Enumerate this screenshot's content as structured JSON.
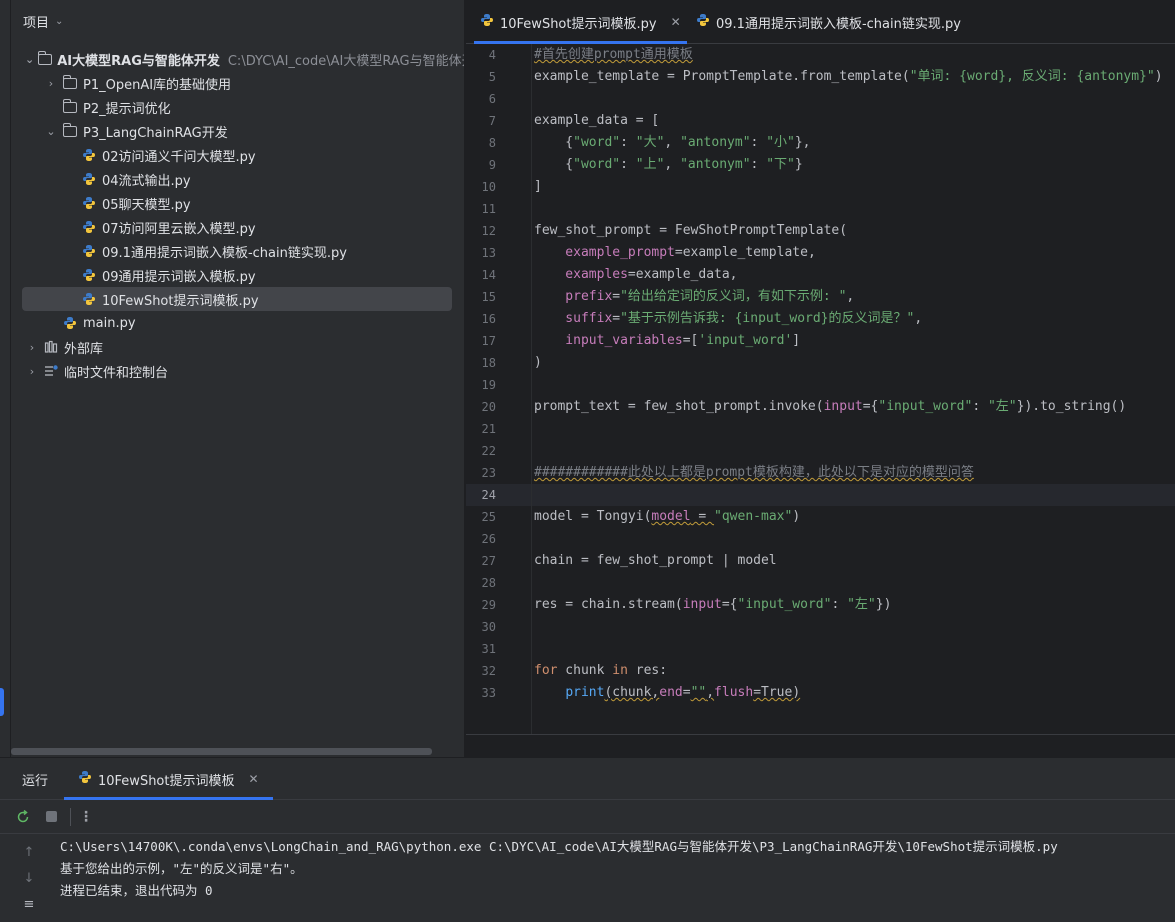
{
  "project_panel": {
    "header": "项目",
    "tree": [
      {
        "label": "AI大模型RAG与智能体开发",
        "path": "C:\\DYC\\AI_code\\AI大模型RAG与智能体开",
        "bold": true
      },
      {
        "label": "P1_OpenAI库的基础使用"
      },
      {
        "label": "P2_提示词优化"
      },
      {
        "label": "P3_LangChainRAG开发"
      },
      {
        "label": "02访问通义千问大模型.py"
      },
      {
        "label": "04流式输出.py"
      },
      {
        "label": "05聊天模型.py"
      },
      {
        "label": "07访问阿里云嵌入模型.py"
      },
      {
        "label": "09.1通用提示词嵌入模板-chain链实现.py"
      },
      {
        "label": "09通用提示词嵌入模板.py"
      },
      {
        "label": "10FewShot提示词模板.py"
      },
      {
        "label": "main.py"
      },
      {
        "label": "外部库"
      },
      {
        "label": "临时文件和控制台"
      }
    ]
  },
  "editor": {
    "tabs": [
      {
        "label": "10FewShot提示词模板.py",
        "active": true
      },
      {
        "label": "09.1通用提示词嵌入模板-chain链实现.py",
        "active": false
      }
    ],
    "line_numbers": [
      "4",
      "5",
      "6",
      "7",
      "8",
      "9",
      "10",
      "11",
      "12",
      "13",
      "14",
      "15",
      "16",
      "17",
      "18",
      "19",
      "20",
      "21",
      "22",
      "23",
      "24",
      "25",
      "26",
      "27",
      "28",
      "29",
      "30",
      "31",
      "32",
      "33"
    ],
    "current_line": "24",
    "code": {
      "l4": "#首先创建prompt通用模板",
      "l5_a": "example_template = PromptTemplate.from_template(",
      "l5_b": "\"单词: {word}, 反义词: {antonym}\"",
      "l5_c": ")",
      "l7": "example_data = [",
      "l8_a": "    {",
      "l8_b": "\"word\"",
      "l8_c": ": ",
      "l8_d": "\"大\"",
      "l8_e": ", ",
      "l8_f": "\"antonym\"",
      "l8_g": ": ",
      "l8_h": "\"小\"",
      "l8_i": "},",
      "l9_a": "    {",
      "l9_b": "\"word\"",
      "l9_c": ": ",
      "l9_d": "\"上\"",
      "l9_e": ", ",
      "l9_f": "\"antonym\"",
      "l9_g": ": ",
      "l9_h": "\"下\"",
      "l9_i": "}",
      "l10": "]",
      "l12": "few_shot_prompt = FewShotPromptTemplate(",
      "l13_a": "    example_prompt",
      "l13_b": "=example_template,",
      "l14_a": "    examples",
      "l14_b": "=example_data,",
      "l15_a": "    prefix",
      "l15_b": "=",
      "l15_c": "\"给出给定词的反义词，有如下示例: \"",
      "l15_d": ",",
      "l16_a": "    suffix",
      "l16_b": "=",
      "l16_c": "\"基于示例告诉我: {input_word}的反义词是？\"",
      "l16_d": ",",
      "l17_a": "    input_variables",
      "l17_b": "=[",
      "l17_c": "'input_word'",
      "l17_d": "]",
      "l18": ")",
      "l20_a": "prompt_text = few_shot_prompt.invoke(",
      "l20_b": "input",
      "l20_c": "={",
      "l20_d": "\"input_word\"",
      "l20_e": ": ",
      "l20_f": "\"左\"",
      "l20_g": "}).to_string()",
      "l23": "############此处以上都是prompt模板构建，此处以下是对应的模型问答",
      "l25_a": "model = Tongyi(",
      "l25_b": "model",
      "l25_c": " = ",
      "l25_d": "\"qwen-max\"",
      "l25_e": ")",
      "l27": "chain = few_shot_prompt | model",
      "l29_a": "res = chain.stream(",
      "l29_b": "input",
      "l29_c": "={",
      "l29_d": "\"input_word\"",
      "l29_e": ": ",
      "l29_f": "\"左\"",
      "l29_g": "})",
      "l32_a": "for",
      "l32_b": " chunk ",
      "l32_c": "in",
      "l32_d": " res:",
      "l33_a": "    ",
      "l33_b": "print",
      "l33_c": "(chunk,",
      "l33_d": "end",
      "l33_e": "=",
      "l33_f": "\"\"",
      "l33_g": ",",
      "l33_h": "flush",
      "l33_i": "=True)"
    }
  },
  "run_panel": {
    "title": "运行",
    "tab_label": "10FewShot提示词模板",
    "output": [
      "C:\\Users\\14700K\\.conda\\envs\\LongChain_and_RAG\\python.exe C:\\DYC\\AI_code\\AI大模型RAG与智能体开发\\P3_LangChainRAG开发\\10FewShot提示词模板.py",
      "基于您给出的示例，\"左\"的反义词是\"右\"。",
      "进程已结束，退出代码为 0"
    ]
  },
  "colors": {
    "accent": "#3574f0",
    "keyword": "#cf8e6d",
    "string": "#6aab73",
    "param": "#c77dbb",
    "comment": "#7a7e85"
  },
  "icons": [
    "chevron-down-icon",
    "folder-icon",
    "python-file-icon",
    "library-icon",
    "scratches-icon",
    "rerun-icon",
    "stop-icon",
    "more-icon",
    "up-arrow-icon",
    "down-arrow-icon",
    "soft-wrap-icon",
    "close-icon"
  ]
}
